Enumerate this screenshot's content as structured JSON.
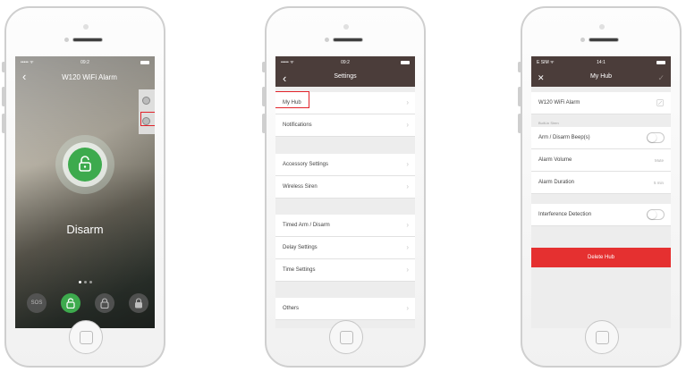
{
  "phones": [
    {
      "status_left": "••••• ᯤ",
      "status_time": "09:2",
      "title": "W120 WiFi Alarm",
      "main_status": "Disarm",
      "mode_buttons": [
        {
          "label": "SOS",
          "icon": "sos-icon"
        },
        {
          "label": "",
          "icon": "unlock-icon"
        },
        {
          "label": "",
          "icon": "home-lock-icon"
        },
        {
          "label": "",
          "icon": "lock-icon"
        }
      ]
    },
    {
      "status_left": "••••• ᯤ",
      "status_time": "09:2",
      "title": "Settings",
      "items": [
        {
          "label": "My Hub"
        },
        {
          "label": "Notifications"
        },
        {
          "label": "Accessory Settings"
        },
        {
          "label": "Wireless Siren"
        },
        {
          "label": "Timed Arm / Disarm"
        },
        {
          "label": "Delay Settings"
        },
        {
          "label": "Time Settings"
        },
        {
          "label": "Others"
        }
      ]
    },
    {
      "status_left": "E SIM ᯤ",
      "status_time": "14:1",
      "title": "My Hub",
      "hub_name": "W120 WiFi Alarm",
      "section_label": "Built-in Siren",
      "items": [
        {
          "label": "Arm / Disarm Beep(s)",
          "value": ""
        },
        {
          "label": "Alarm Volume",
          "value": "Mute"
        },
        {
          "label": "Alarm Duration",
          "value": "5 min"
        }
      ],
      "interference_label": "Interference Detection",
      "delete_label": "Delete Hub"
    }
  ]
}
